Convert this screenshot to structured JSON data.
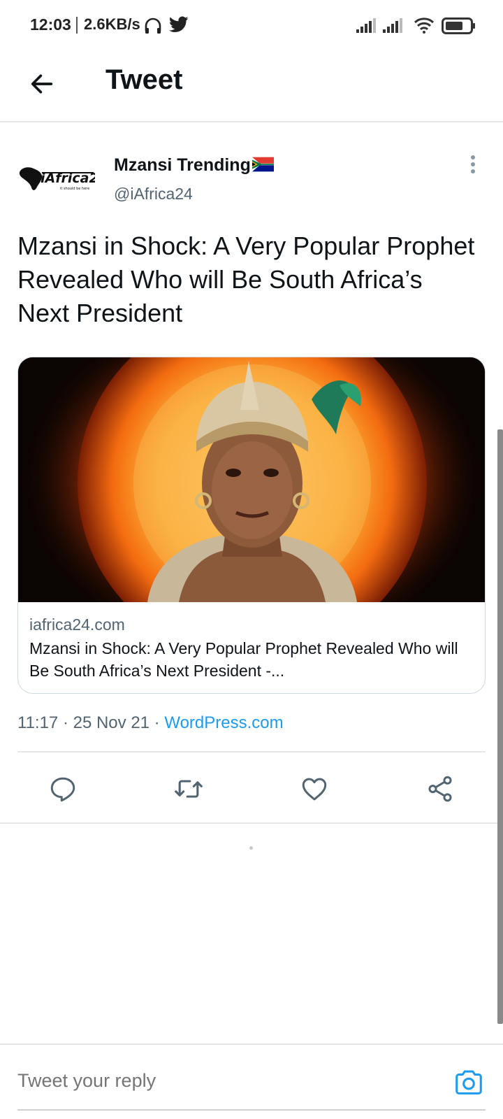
{
  "status_bar": {
    "time": "12:03",
    "network_speed": "2.6KB/s",
    "icons": [
      "headphones-icon",
      "twitter-bird-icon",
      "signal-icon",
      "signal-icon",
      "wifi-icon",
      "battery-icon"
    ]
  },
  "header": {
    "back_icon": "arrow-left-icon",
    "title": "Tweet"
  },
  "tweet": {
    "author": {
      "avatar_text": "iAfrica24",
      "avatar_tagline": "it should be here",
      "name": "Mzansi Trending",
      "name_emoji": "south-africa-flag",
      "handle": "@iAfrica24"
    },
    "more_icon": "more-vertical-icon",
    "text": "Mzansi in Shock: A Very Popular Prophet Revealed Who will Be South Africa’s Next President",
    "card": {
      "domain": "iafrica24.com",
      "title": "Mzansi in Shock: A Very Popular Prophet Revealed Who will Be South Africa’s Next President -..."
    },
    "meta": {
      "time": "11:17",
      "separator": " · ",
      "date": "25 Nov 21",
      "source": "WordPress.com"
    },
    "actions": [
      "reply-icon",
      "retweet-icon",
      "like-icon",
      "share-icon"
    ]
  },
  "reply_bar": {
    "placeholder": "Tweet your reply",
    "camera_icon": "camera-icon"
  },
  "colors": {
    "accent": "#1d9bf0",
    "text_primary": "#0f1419",
    "text_secondary": "#536471",
    "divider": "#e6e6e6"
  }
}
